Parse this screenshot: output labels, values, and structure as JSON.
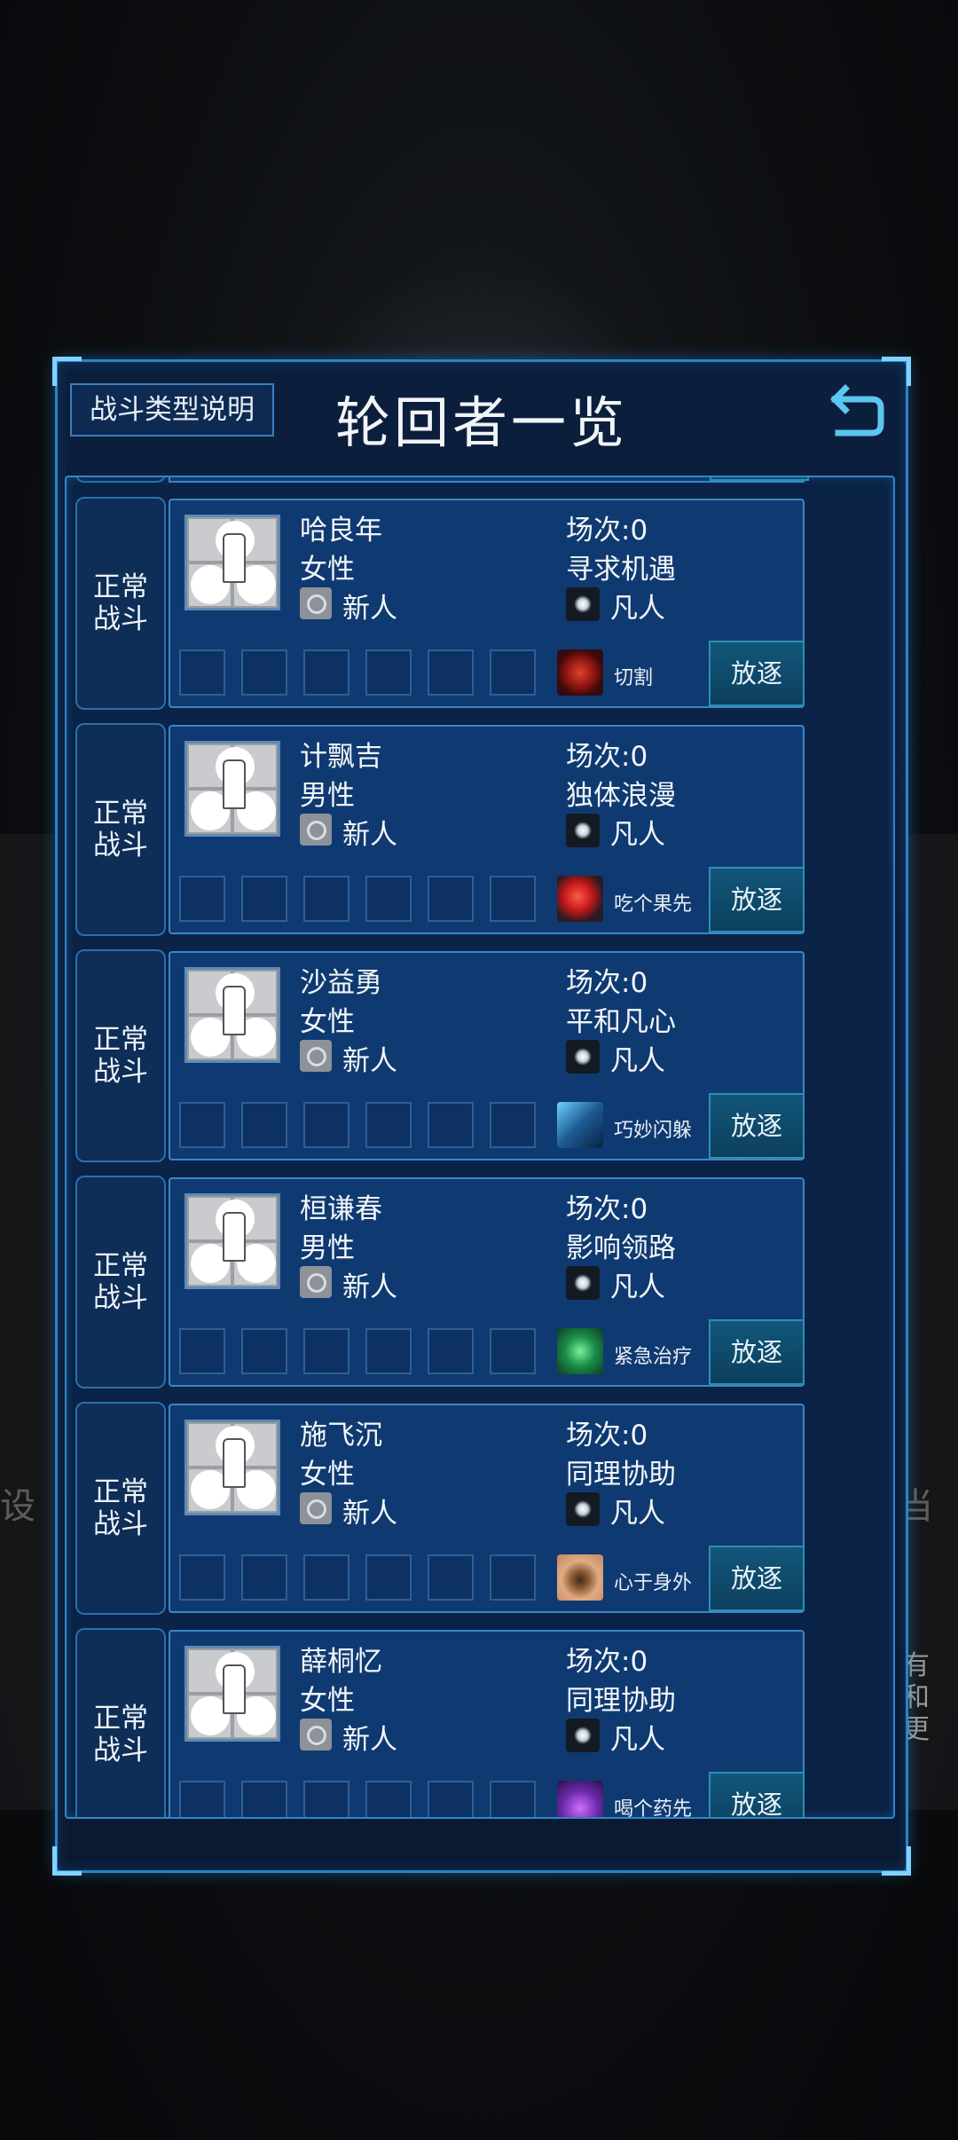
{
  "header": {
    "help_label": "战斗类型说明",
    "title": "轮回者一览"
  },
  "background": {
    "left_text": "设",
    "right_top_text": "当",
    "right_text": "有和更"
  },
  "colors": {
    "panel": "#0a1a33",
    "card": "#0f3a71",
    "accent": "#2d83c8",
    "button": "#0c3f5e"
  },
  "rows": [
    {
      "type_label": "正常战斗",
      "name": "哈良年",
      "gender": "女性",
      "rank": "新人",
      "count": "场次:0",
      "trait": "寻求机遇",
      "fate": "凡人",
      "skill": "切割",
      "skill_icon": "claw-icon",
      "action": "放逐"
    },
    {
      "type_label": "正常战斗",
      "name": "计飘吉",
      "gender": "男性",
      "rank": "新人",
      "count": "场次:0",
      "trait": "独体浪漫",
      "fate": "凡人",
      "skill": "吃个果先",
      "skill_icon": "apple-icon",
      "action": "放逐"
    },
    {
      "type_label": "正常战斗",
      "name": "沙益勇",
      "gender": "女性",
      "rank": "新人",
      "count": "场次:0",
      "trait": "平和凡心",
      "fate": "凡人",
      "skill": "巧妙闪躲",
      "skill_icon": "dodge-icon",
      "action": "放逐"
    },
    {
      "type_label": "正常战斗",
      "name": "桓谦春",
      "gender": "男性",
      "rank": "新人",
      "count": "场次:0",
      "trait": "影响领路",
      "fate": "凡人",
      "skill": "紧急治疗",
      "skill_icon": "heal-cross-icon",
      "action": "放逐"
    },
    {
      "type_label": "正常战斗",
      "name": "施飞沉",
      "gender": "女性",
      "rank": "新人",
      "count": "场次:0",
      "trait": "同理协助",
      "fate": "凡人",
      "skill": "心于身外",
      "skill_icon": "eye-icon",
      "action": "放逐"
    },
    {
      "type_label": "正常战斗",
      "name": "薛桐忆",
      "gender": "女性",
      "rank": "新人",
      "count": "场次:0",
      "trait": "同理协助",
      "fate": "凡人",
      "skill": "喝个药先",
      "skill_icon": "potion-icon",
      "action": "放逐"
    }
  ]
}
